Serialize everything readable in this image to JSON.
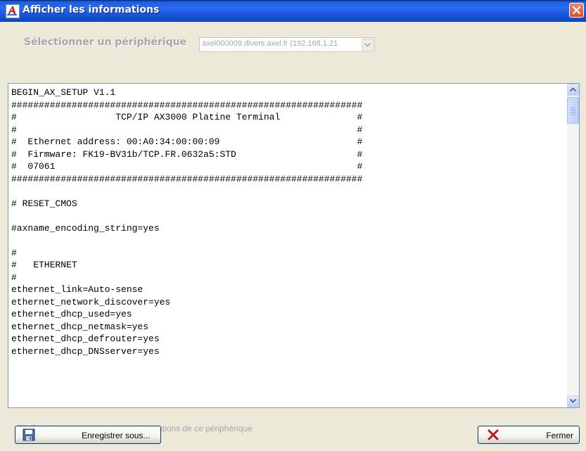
{
  "window": {
    "title": "Afficher les informations",
    "icon": "app-a-icon",
    "close_icon": "close-icon"
  },
  "device": {
    "label": "Sélectionner un périphérique",
    "selected": "axel000009.divers.axel.fr (192.168.1.21"
  },
  "content": {
    "lines": [
      "BEGIN_AX_SETUP V1.1",
      "################################################################",
      "#                  TCP/IP AX3000 Platine Terminal              #",
      "#                                                              #",
      "#  Ethernet address: 00:A0:34:00:00:09                         #",
      "#  Firmware: FK19-BV31b/TCP.FR.0632a5:STD                      #",
      "#  07061                                                       #",
      "################################################################",
      "",
      "# RESET_CMOS",
      "",
      "#axname_encoding_string=yes",
      "",
      "#",
      "#   ETHERNET",
      "#",
      "ethernet_link=Auto-sense",
      "ethernet_network_discover=yes",
      "ethernet_dhcp_used=yes",
      "ethernet_dhcp_netmask=yes",
      "ethernet_dhcp_defrouter=yes",
      "ethernet_dhcp_DNSserver=yes"
    ]
  },
  "options": {
    "save_only_this_device_label": "Enregistrer uniquement les informations de ce périphérique",
    "save_only_this_device_checked": false
  },
  "buttons": {
    "save_as": {
      "label": "Enregistrer sous...",
      "icon": "floppy-disk-icon"
    },
    "close": {
      "label": "Fermer",
      "icon": "red-x-icon"
    }
  }
}
